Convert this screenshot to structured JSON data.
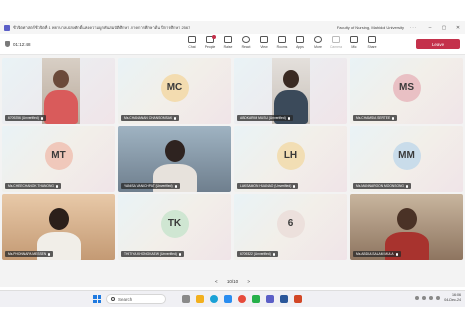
{
  "window": {
    "title": "ชีวจิตศาสตร์ชีวจิตที่ 1 พยาบาลเปล่งศักดิ์แห่งความผูกพันสมบัติศึกษา ภาคการศึกษาต้น ปีการศึกษา 2567",
    "org": "Faculty of Nursing, Mahidol University"
  },
  "toolbar": {
    "timer": "01:12:48",
    "tools": [
      {
        "label": "Chat",
        "icon": "chat-icon"
      },
      {
        "label": "People",
        "icon": "people-icon"
      },
      {
        "label": "Raise",
        "icon": "hand-icon"
      },
      {
        "label": "React",
        "icon": "smile-icon"
      },
      {
        "label": "View",
        "icon": "grid-icon"
      },
      {
        "label": "Rooms",
        "icon": "rooms-icon"
      },
      {
        "label": "Apps",
        "icon": "apps-icon"
      },
      {
        "label": "More",
        "icon": "more-icon"
      },
      {
        "label": "Camera",
        "icon": "camera-icon"
      },
      {
        "label": "Mic",
        "icon": "mic-icon"
      },
      {
        "label": "Share",
        "icon": "share-icon"
      }
    ],
    "leave_label": "Leave"
  },
  "tiles": [
    {
      "name": "6709256 (Unverified)",
      "initials": "",
      "video": true
    },
    {
      "name": "Ms.CHANANAN CHANSOMSAK",
      "initials": "MC",
      "video": false,
      "color": "#f3dcb0"
    },
    {
      "name": "ABDKARIM MUSU (Unverified)",
      "initials": "",
      "video": true
    },
    {
      "name": "Ms.CHAMSIA SERTEE",
      "initials": "MS",
      "video": false,
      "color": "#e9c0c4"
    },
    {
      "name": "Ms.CHEECHANOK THANONG",
      "initials": "MT",
      "video": false,
      "color": "#f0c8bb"
    },
    {
      "name": "YANISA VANICHPAT (Unverified)",
      "initials": "",
      "video": true
    },
    {
      "name": "LAKSAMON HUANAO (Unverified)",
      "initials": "LH",
      "video": false,
      "color": "#f2deb4"
    },
    {
      "name": "Ms.MANNAROON MOONSONG",
      "initials": "MM",
      "video": false,
      "color": "#c9dcea"
    },
    {
      "name": "Ms.PHONNAPA MESSEN",
      "initials": "",
      "video": true
    },
    {
      "name": "THITIYA KHONGKAEW (Unverified)",
      "initials": "TK",
      "video": false,
      "color": "#cfe6d2"
    },
    {
      "name": "6709322 (Unverified)",
      "initials": "6",
      "video": false,
      "color": "#ece0dc"
    },
    {
      "name": "Ms.ABDULSALAM MULA",
      "initials": "",
      "video": true
    }
  ],
  "pager": {
    "prev": "<",
    "page": "10/10",
    "next": ">"
  },
  "taskbar": {
    "search_placeholder": "Search",
    "time": "16:06",
    "date": "04-Dec-24"
  }
}
